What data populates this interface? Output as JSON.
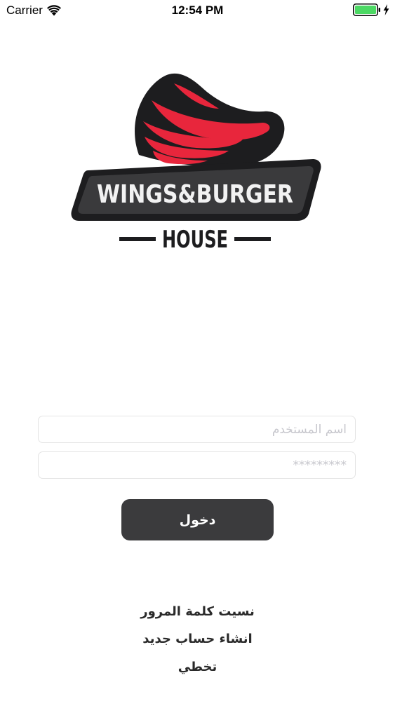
{
  "status_bar": {
    "carrier": "Carrier",
    "time": "12:54 PM",
    "wifi_icon": "wifi-icon",
    "battery_icon": "battery-full-icon",
    "charging_icon": "charging-bolt-icon",
    "battery_color": "#4cd964"
  },
  "logo": {
    "line1": "WINGS&BURGER",
    "line2": "HOUSE",
    "colors": {
      "outline": "#1d1d1f",
      "wing": "#e8263c",
      "panel": "#3a3a3c",
      "text": "#f2f2f2"
    }
  },
  "form": {
    "username_placeholder": "اسم المستخدم",
    "password_placeholder": "*********",
    "login_label": "دخول",
    "button_color": "#3b3b3d"
  },
  "links": {
    "forgot_password": "نسيت كلمة المرور",
    "create_account": "انشاء حساب جديد",
    "skip": "تخطي"
  }
}
